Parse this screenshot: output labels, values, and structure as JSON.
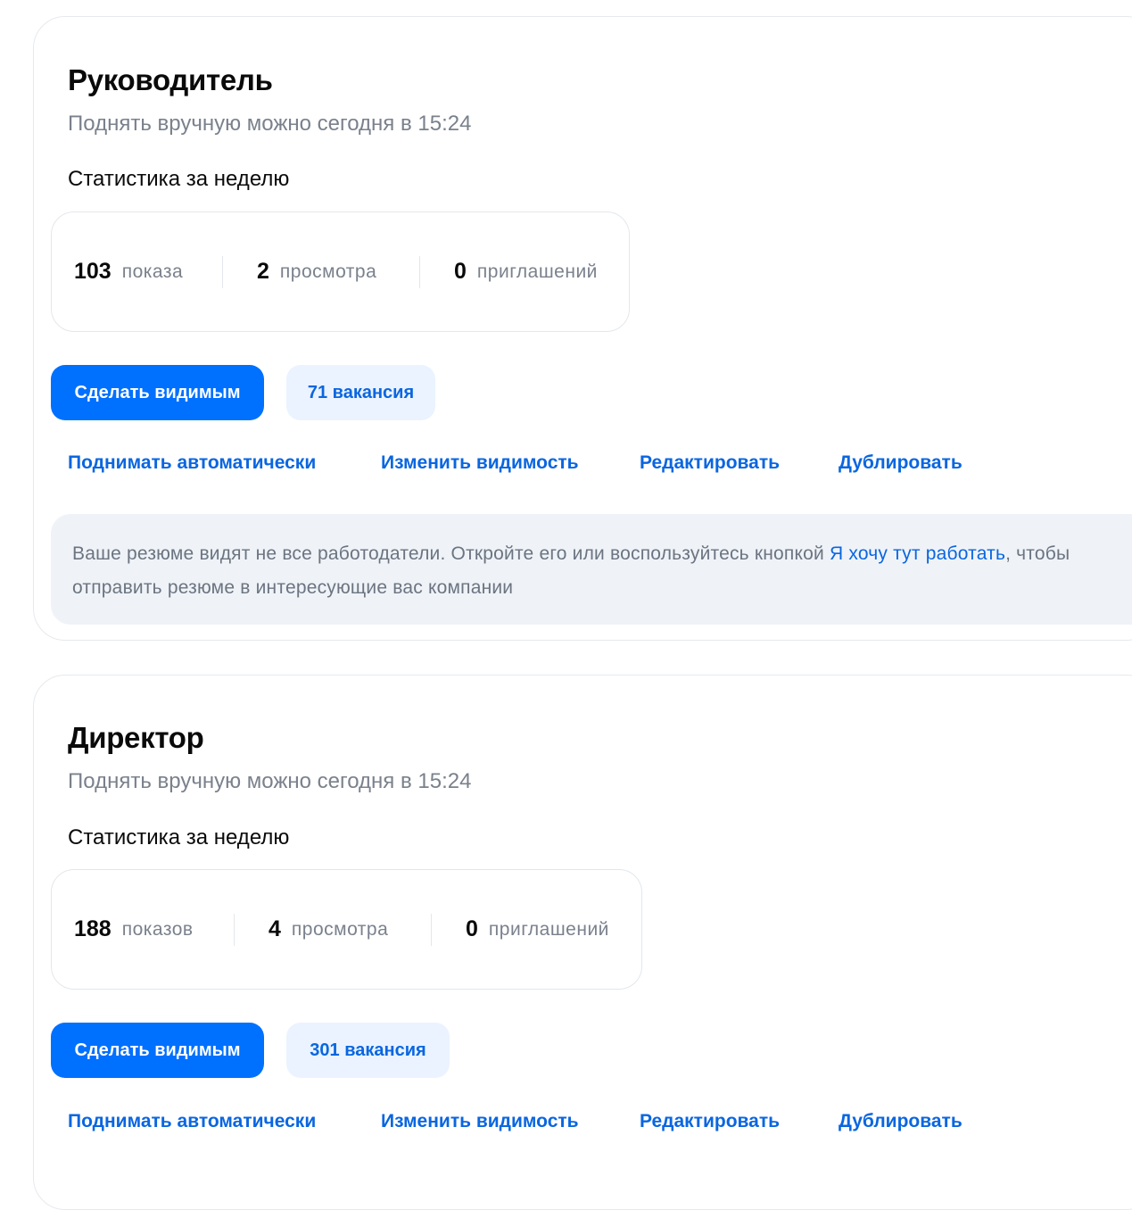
{
  "resumes": [
    {
      "title": "Руководитель",
      "raise_info": "Поднять вручную можно сегодня в 15:24",
      "stats_label": "Статистика за неделю",
      "stats": [
        {
          "value": "103",
          "label": "показа"
        },
        {
          "value": "2",
          "label": "просмотра"
        },
        {
          "value": "0",
          "label": "приглашений"
        }
      ],
      "primary_button": "Сделать видимым",
      "vacancies_button": "71 вакансия",
      "links": [
        "Поднимать автоматически",
        "Изменить видимость",
        "Редактировать",
        "Дублировать"
      ],
      "notice": {
        "text_before": "Ваше резюме видят не все работодатели. Откройте его или воспользуйтесь кнопкой ",
        "link": "Я хочу тут работать",
        "text_after": ", чтобы отправить резюме в интересующие вас компании"
      }
    },
    {
      "title": "Директор",
      "raise_info": "Поднять вручную можно сегодня в 15:24",
      "stats_label": "Статистика за неделю",
      "stats": [
        {
          "value": "188",
          "label": "показов"
        },
        {
          "value": "4",
          "label": "просмотра"
        },
        {
          "value": "0",
          "label": "приглашений"
        }
      ],
      "primary_button": "Сделать видимым",
      "vacancies_button": "301 вакансия",
      "links": [
        "Поднимать автоматически",
        "Изменить видимость",
        "Редактировать",
        "Дублировать"
      ]
    }
  ],
  "colors": {
    "accent": "#0070ff",
    "link": "#0a66e0",
    "muted_text": "#7a818c",
    "notice_bg": "#eff3f8",
    "secondary_button_bg": "#eaf3ff"
  }
}
